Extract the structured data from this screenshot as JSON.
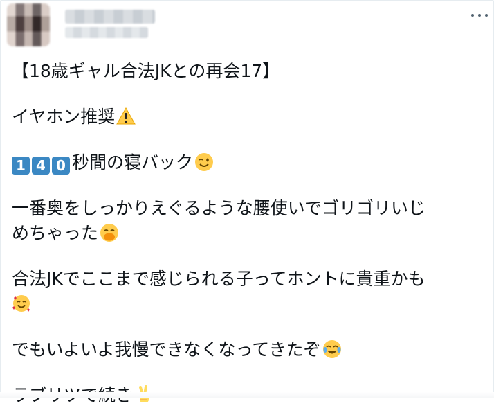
{
  "post": {
    "title_line": "【18歳ギャル合法JKとの再会17】",
    "line1": "イヤホン推奨",
    "line2_digits": [
      "1",
      "4",
      "0"
    ],
    "line2_text": "秒間の寝バック",
    "line3a": "一番奥をしっかりえぐるような腰使いでゴリゴリいじ",
    "line3b": "めちゃった",
    "line4": "合法JKでここまで感じられる子ってホントに貴重かも",
    "line5": "でもいよいよ我慢できなくなってきたぞ",
    "line6": "ラブリツで続き"
  },
  "icons": {
    "warning": "warning-emoji",
    "wink": "winking-face-emoji",
    "blush_hands": "face-with-hand-over-mouth-emoji",
    "hearts": "smiling-face-with-hearts-emoji",
    "tears": "face-with-tears-of-joy-emoji",
    "victory": "victory-hand-emoji",
    "more": "more-icon"
  },
  "colors": {
    "text": "#0f1419",
    "keycap": "#3b88c3",
    "muted": "#536471"
  }
}
